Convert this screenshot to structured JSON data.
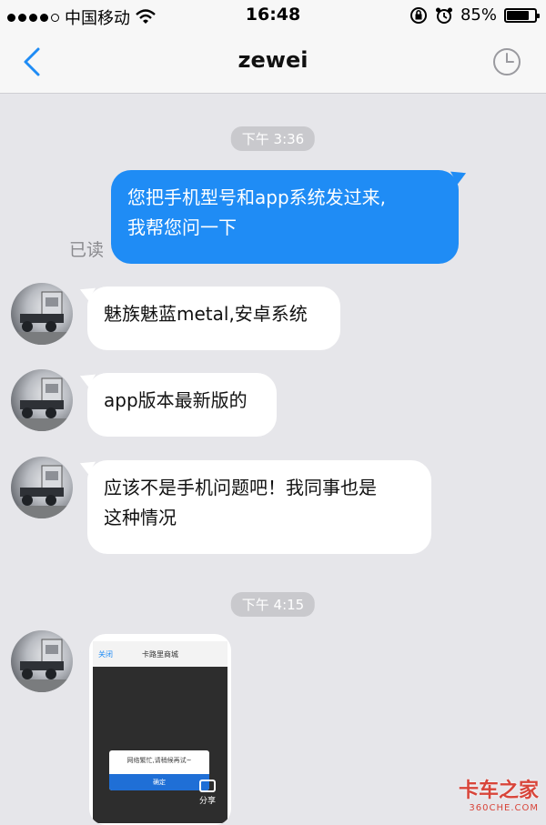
{
  "status_bar": {
    "carrier": "中国移动",
    "time": "16:48",
    "battery": "85%",
    "battery_level": 0.85
  },
  "nav": {
    "title": "zewei",
    "back_icon": "chevron-left-icon",
    "history_icon": "clock-icon"
  },
  "chat": {
    "time_1": "下午 3:36",
    "time_2": "下午 4:15",
    "read_receipt": "已读",
    "messages": [
      {
        "side": "out",
        "text_line1": "您把手机型号和app系统发过来,",
        "text_line2": "我帮您问一下"
      },
      {
        "side": "in",
        "text": "魅族魅蓝metal,安卓系统"
      },
      {
        "side": "in",
        "text": "app版本最新版的"
      },
      {
        "side": "in",
        "text_line1": "应该不是手机问题吧！我同事也是",
        "text_line2": "这种情况"
      }
    ],
    "image_message": {
      "top_back": "关闭",
      "top_title": "卡路里商城",
      "dialog_text": "网络繁忙,请稍候再试~",
      "dialog_button": "确定",
      "share_label": "分享"
    }
  },
  "watermark": {
    "logo_text": "卡车之家",
    "domain": "360CHE.COM"
  },
  "colors": {
    "accent": "#1f8cf5",
    "background": "#e6e6ea"
  }
}
